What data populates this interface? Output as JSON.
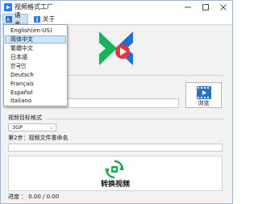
{
  "window": {
    "title": "视频格式工厂",
    "minimize_icon": "minimize-icon",
    "maximize_icon": "maximize-icon",
    "close_icon": "close-icon"
  },
  "menubar": {
    "items": [
      {
        "label": "语言",
        "icon": "language-icon"
      },
      {
        "label": "关于",
        "icon": "info-icon"
      }
    ]
  },
  "language_menu": {
    "items": [
      {
        "label": "English(en-US)"
      },
      {
        "label": "简体中文",
        "selected": true
      },
      {
        "label": "繁體中文"
      },
      {
        "label": "日本語"
      },
      {
        "label": "한국인"
      },
      {
        "label": "Deutsch"
      },
      {
        "label": "Français"
      },
      {
        "label": "Español"
      },
      {
        "label": "Italiano"
      }
    ]
  },
  "colors": {
    "logo_green": "#19b35a",
    "logo_blue": "#1f6fd6",
    "logo_red": "#e0393b",
    "accent_selection": "#cce4f7"
  },
  "step1": {
    "input_value": ""
  },
  "browse_button": {
    "label": "浏览",
    "icon": "film-icon"
  },
  "target_format": {
    "label": "视频目标格式",
    "selected": "3GP"
  },
  "step2": {
    "label": "第2步：视频文件重命名",
    "input_value": ""
  },
  "convert_button": {
    "label": "转换视频",
    "icon": "convert-icon"
  },
  "progress": {
    "label": "进度",
    "value": "： 0.00 / 0.00"
  }
}
